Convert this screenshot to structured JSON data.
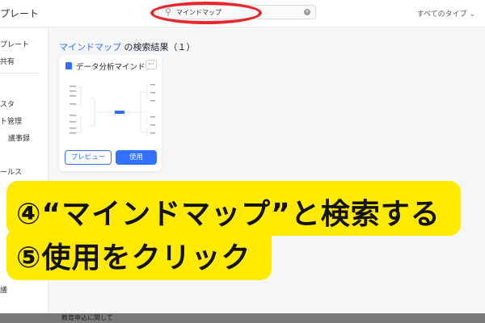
{
  "header": {
    "app_title": "プレート",
    "search_value": "マインドマップ",
    "type_filter": "すべてのタイプ ⌄"
  },
  "sidebar": {
    "items": [
      "プレート",
      "共有",
      "スタ",
      "ト管理",
      "議事録",
      "ールス",
      "議"
    ]
  },
  "results": {
    "keyword": "マインドマップ",
    "suffix": " の検索結果（１）"
  },
  "card": {
    "title": "データ分析マインドマップ",
    "more": "···",
    "preview_label": "プレビュー",
    "use_label": "使用"
  },
  "callout": {
    "line1": "④“マインドマップ”と検索する",
    "line2": "⑤使用をクリック",
    "color": "#ffea00"
  },
  "bottom": {
    "text": "教育申込に関して"
  }
}
